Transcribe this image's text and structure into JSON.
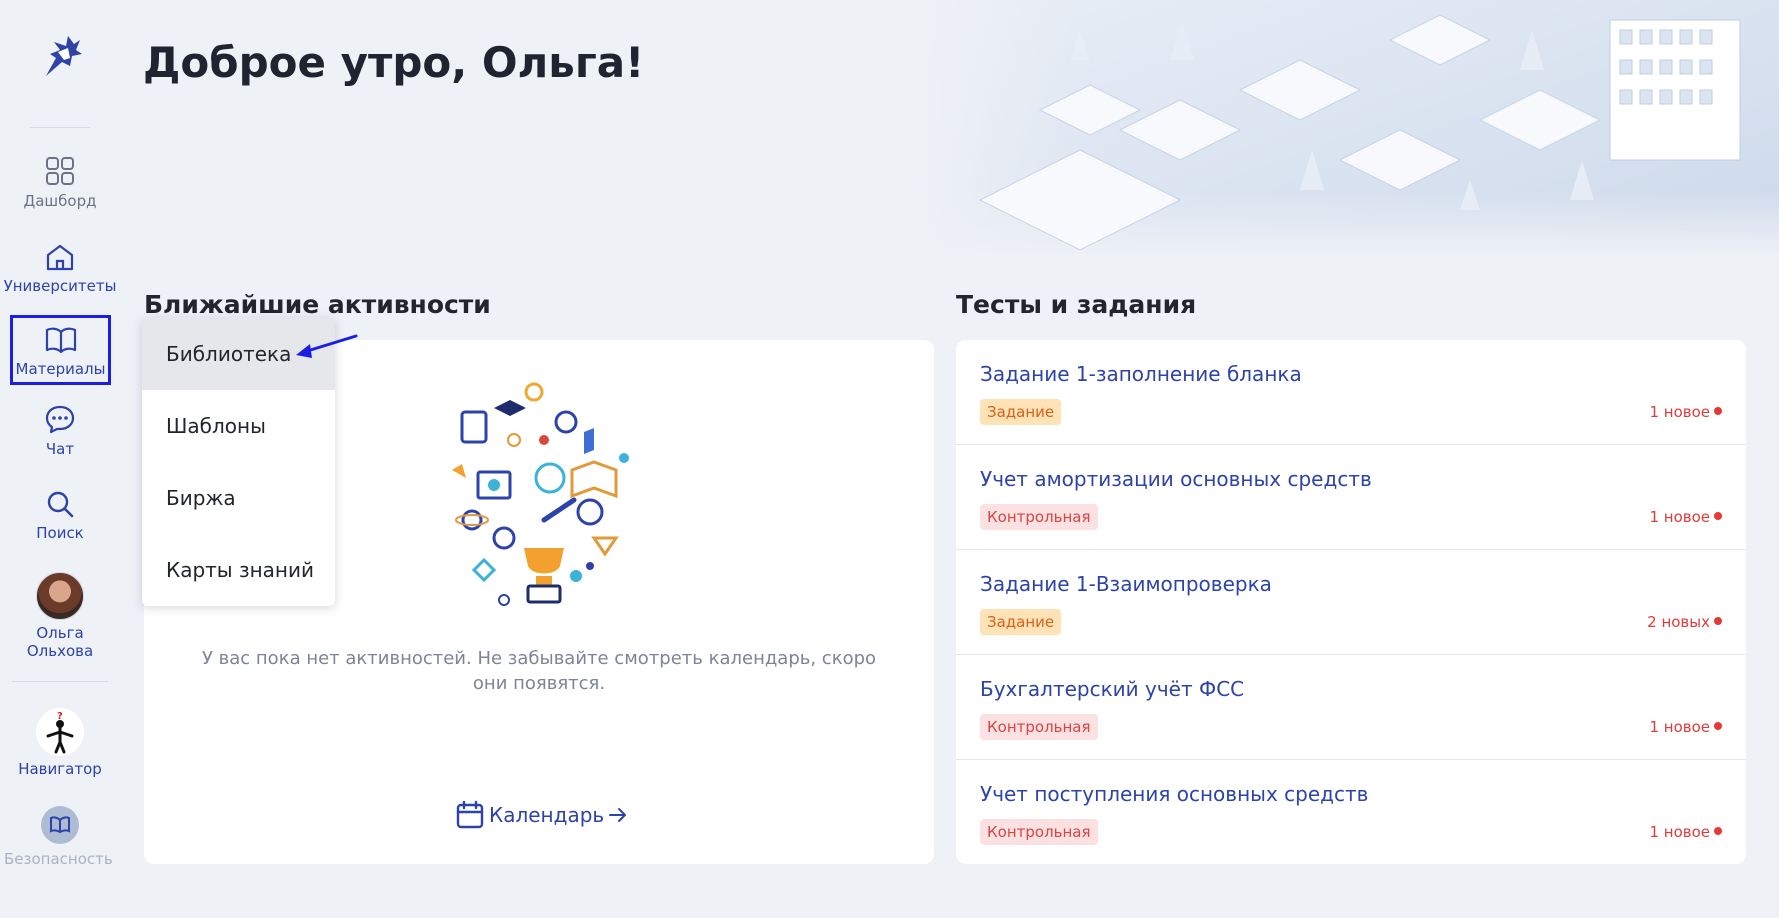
{
  "greeting": "Доброе утро, Ольга!",
  "sidebar": {
    "items": [
      {
        "label": "Дашборд",
        "icon": "grid-icon"
      },
      {
        "label": "Университеты",
        "icon": "home-icon"
      },
      {
        "label": "Материалы",
        "icon": "book-icon"
      },
      {
        "label": "Чат",
        "icon": "chat-icon"
      },
      {
        "label": "Поиск",
        "icon": "search-icon"
      }
    ],
    "user": {
      "first_name": "Ольга",
      "last_name": "Ольхова"
    },
    "navigator": {
      "label": "Навигатор"
    },
    "course": {
      "label": "Безопасность жизнедеятельн"
    }
  },
  "activities": {
    "title": "Ближайшие активности",
    "empty_text": "У вас пока нет активностей. Не забывайте смотреть календарь, скоро они появятся.",
    "calendar_link": "Календарь"
  },
  "materials_menu": {
    "items": [
      "Библиотека",
      "Шаблоны",
      "Биржа",
      "Карты знаний"
    ]
  },
  "tests": {
    "title": "Тесты и задания",
    "items": [
      {
        "title": "Задание 1-заполнение бланка",
        "type": "Задание",
        "new": "1 новое"
      },
      {
        "title": "Учет амортизации основных средств",
        "type": "Контрольная",
        "new": "1 новое"
      },
      {
        "title": "Задание 1-Взаимопроверка",
        "type": "Задание",
        "new": "2 новых"
      },
      {
        "title": "Бухгалтерский учёт ФСС",
        "type": "Контрольная",
        "new": "1 новое"
      },
      {
        "title": "Учет поступления основных средств",
        "type": "Контрольная",
        "new": "1 новое"
      }
    ]
  },
  "colors": {
    "accent": "#2d43a8",
    "highlight_box": "#1b1fe6",
    "badge_task_bg": "#ffe2b5",
    "badge_control_bg": "#fbe1e1",
    "new_dot": "#e53935"
  }
}
